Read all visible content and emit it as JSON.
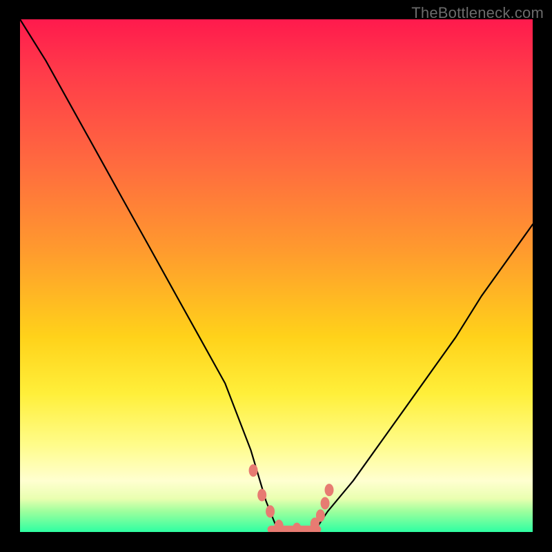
{
  "watermark": "TheBottleneck.com",
  "chart_data": {
    "type": "line",
    "title": "",
    "xlabel": "",
    "ylabel": "",
    "xlim": [
      0,
      100
    ],
    "ylim": [
      0,
      100
    ],
    "grid": false,
    "legend": false,
    "curve": {
      "name": "bottleneck-curve",
      "color": "#000000",
      "x": [
        0,
        5,
        10,
        15,
        20,
        25,
        30,
        35,
        40,
        45,
        48,
        50,
        52,
        55,
        58,
        60,
        65,
        70,
        75,
        80,
        85,
        90,
        95,
        100
      ],
      "y": [
        100,
        92,
        83,
        74,
        65,
        56,
        47,
        38,
        29,
        16,
        6,
        1,
        0.5,
        0.5,
        1,
        4,
        10,
        17,
        24,
        31,
        38,
        46,
        53,
        60
      ]
    },
    "markers": {
      "name": "highlight-points",
      "color": "#e77b72",
      "x": [
        45.5,
        47.2,
        48.8,
        50.5,
        54.0,
        57.5,
        58.6,
        59.5,
        60.3
      ],
      "y": [
        12.0,
        7.2,
        4.0,
        1.2,
        0.6,
        1.6,
        3.2,
        5.6,
        8.2
      ]
    },
    "flat_segment": {
      "color": "#e77b72",
      "x0": 49.0,
      "x1": 58.0,
      "y": 0.5
    },
    "background_gradient": {
      "top": "#ff1a4d",
      "mid1": "#ff9a2e",
      "mid2": "#ffef3a",
      "bottom": "#2effa2"
    }
  }
}
